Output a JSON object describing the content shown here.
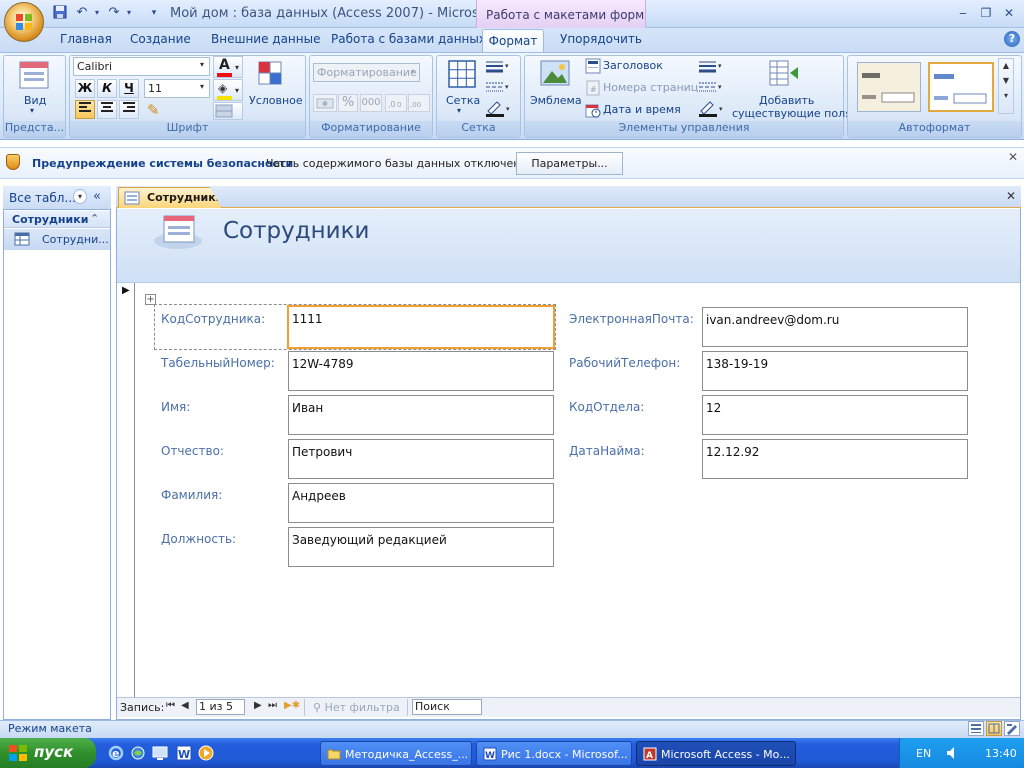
{
  "window": {
    "title": "Мой дом : база данных (Access 2007) - Micros...",
    "context_tab_group": "Работа с макетами форм",
    "min": "‒",
    "restore": "❐",
    "close": "✕"
  },
  "tabs": [
    "Главная",
    "Создание",
    "Внешние данные",
    "Работа с базами данных",
    "Формат",
    "Упорядочить"
  ],
  "ribbon": {
    "groups": {
      "views": {
        "label": "Предста...",
        "view_button": "Вид"
      },
      "font": {
        "label": "Шрифт",
        "font_name": "Calibri",
        "font_size": "11",
        "bold": "Ж",
        "italic": "К",
        "underline": "Ч",
        "conditional": "Условное"
      },
      "formatting": {
        "label": "Форматирование",
        "format_combo": "Форматирование",
        "percent": "%",
        "thousands": "000"
      },
      "gridlines": {
        "label": "Сетка",
        "gridlines_button": "Сетка"
      },
      "controls": {
        "label": "Элементы управления",
        "logo": "Эмблема",
        "title": "Заголовок",
        "page_numbers": "Номера страниц",
        "date_time": "Дата и время",
        "add_fields_1": "Добавить",
        "add_fields_2": "существующие поля"
      },
      "autoformat": {
        "label": "Автоформат"
      }
    }
  },
  "security_bar": {
    "title": "Предупреждение системы безопасности",
    "message": "Часть содержимого базы данных отключено",
    "button": "Параметры..."
  },
  "nav_pane": {
    "header": "Все табл...",
    "group": "Сотрудники",
    "item": "Сотрудни..."
  },
  "document": {
    "tab": "Сотрудники",
    "form_title": "Сотрудники",
    "fields_left": [
      {
        "label": "КодСотрудника:",
        "value": "1111"
      },
      {
        "label": "ТабельныйНомер:",
        "value": "12W-4789"
      },
      {
        "label": "Имя:",
        "value": "Иван"
      },
      {
        "label": "Отчество:",
        "value": "Петрович"
      },
      {
        "label": "Фамилия:",
        "value": "Андреев"
      },
      {
        "label": "Должность:",
        "value": "Заведующий редакцией"
      }
    ],
    "fields_right": [
      {
        "label": "ЭлектроннаяПочта:",
        "value": "ivan.andreev@dom.ru"
      },
      {
        "label": "РабочийТелефон:",
        "value": "138-19-19"
      },
      {
        "label": "КодОтдела:",
        "value": "12"
      },
      {
        "label": "ДатаНайма:",
        "value": "12.12.92"
      }
    ],
    "record_nav": {
      "label": "Запись:",
      "position": "1 из 5",
      "filter": "Нет фильтра",
      "search": "Поиск"
    }
  },
  "status_bar": {
    "text": "Режим макета"
  },
  "taskbar": {
    "start": "пуск",
    "tasks": [
      "Методичка_Access_...",
      "Рис 1.docx - Microsof...",
      "Microsoft Access - Мо..."
    ],
    "lang": "EN",
    "clock": "13:40"
  },
  "colors": {
    "accent": "#15428b",
    "active_tab": "#fbd57a",
    "selection": "#e6a84a"
  }
}
